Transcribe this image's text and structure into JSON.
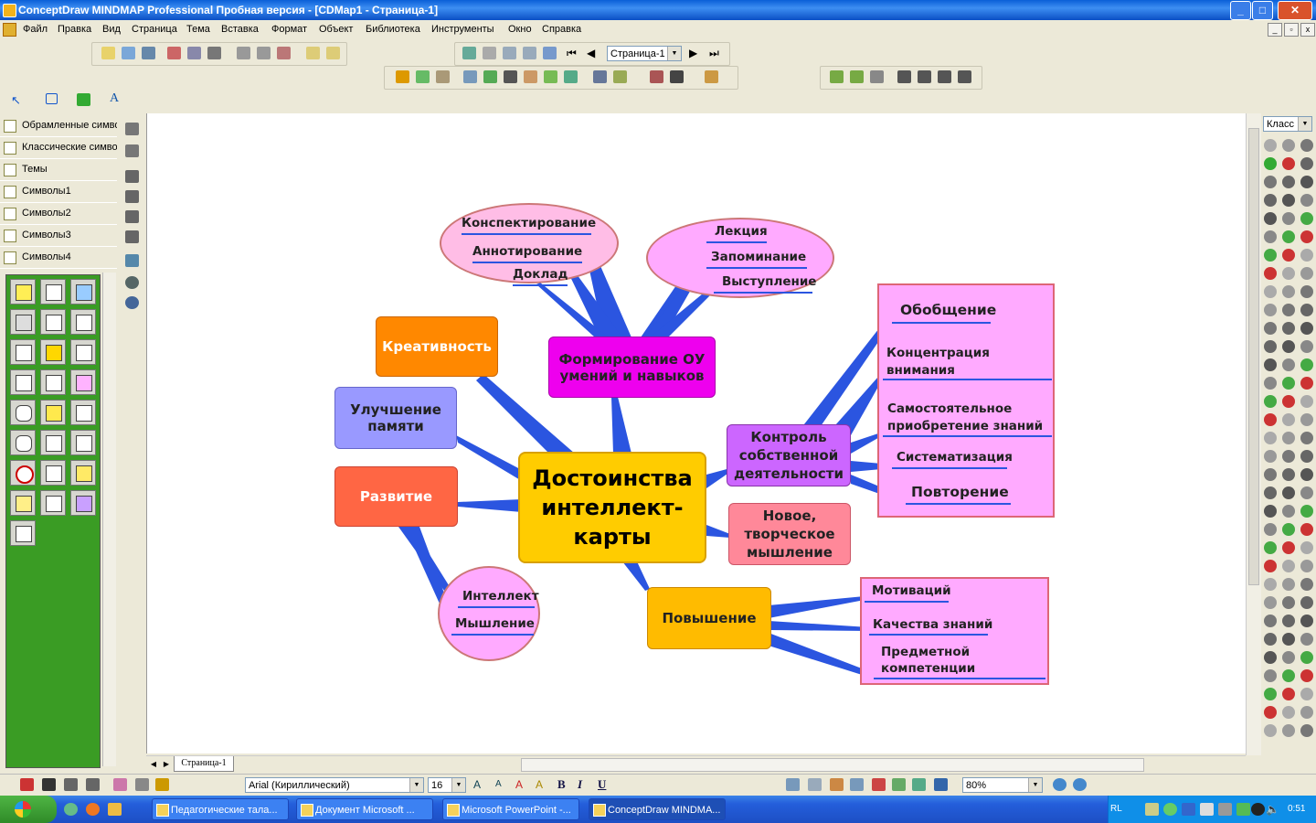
{
  "window": {
    "title": "ConceptDraw MINDMAP Professional Пробная версия - [CDMap1 - Страница-1]",
    "min": "_",
    "max": "□",
    "close": "✕"
  },
  "menu": [
    "Файл",
    "Правка",
    "Вид",
    "Страница",
    "Тема",
    "Вставка",
    "Формат",
    "Объект",
    "Библиотека",
    "Инструменты",
    "Окно",
    "Справка"
  ],
  "toolbar": {
    "page_select": "Страница-1",
    "draw_tool_letter": "A"
  },
  "libraries": [
    "Обрамленные симво",
    "Классические симво",
    "Темы",
    "Символы1",
    "Символы2",
    "Символы3",
    "Символы4"
  ],
  "mindmap": {
    "central": "Достоинства интеллект-карты",
    "nodes": {
      "formirovanie": "Формирование ОУ умений и навыков",
      "kreativnost": "Креативность",
      "uluchshenie": "Улучшение памяти",
      "razvitie": "Развитие",
      "kontrol": "Контроль собственной деятельности",
      "novoe": "Новое, творческое мышление",
      "povyshenie": "Повышение"
    },
    "labels": {
      "konspektirovanie": "Конспектирование",
      "annotirovanie": "Аннотирование",
      "doklad": "Доклад",
      "lekciya": "Лекция",
      "zapominanie": "Запоминание",
      "vystuplenie": "Выступление",
      "obobshenie": "Обобщение",
      "koncentraciya": "Концентрация внимания",
      "samostoyatelnoe": "Самостоятельное приобретение знаний",
      "sistematizaciya": "Систематизация",
      "povtorenie": "Повторение",
      "intellekt": "Интеллект",
      "myshlenie": "Мышление",
      "motivaciy": "Мотиваций",
      "kachestva": "Качества знаний",
      "predmetnoy": "Предметной компетенции"
    }
  },
  "page_tab": "Страница-1",
  "right_panel": {
    "combo": "Класс"
  },
  "format_bar": {
    "font": "Arial (Кириллический)",
    "size": "16",
    "bold": "B",
    "italic": "I",
    "underline": "U",
    "zoom": "80%"
  },
  "taskbar": {
    "tasks": [
      "Педагогические тала...",
      "Документ Microsoft ...",
      "Microsoft PowerPoint -...",
      "ConceptDraw MINDMA..."
    ],
    "lang": "RL",
    "clock": "0:51"
  },
  "colors": {
    "branch": "#2b55e0",
    "central": "#ffcc00",
    "accent_green": "#3a9c24"
  }
}
